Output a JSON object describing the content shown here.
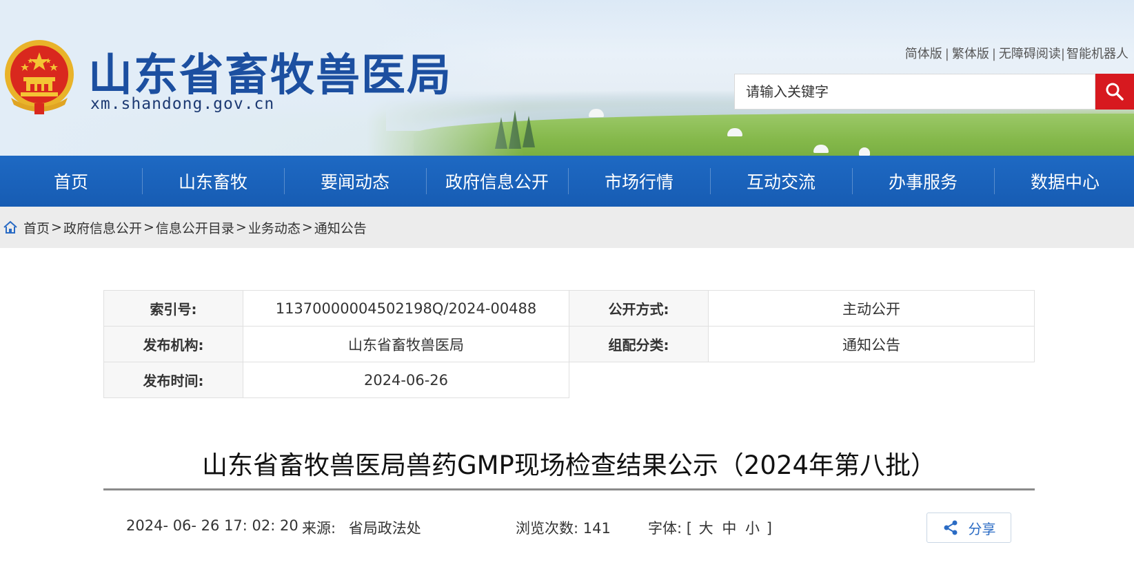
{
  "header": {
    "site_title": "山东省畜牧兽医局",
    "site_domain": "xm.shandong.gov.cn",
    "top_links": [
      "简体版",
      "繁体版",
      "无障碍阅读",
      "智能机器人"
    ],
    "search": {
      "placeholder": "请输入关键字"
    }
  },
  "nav": {
    "items": [
      "首页",
      "山东畜牧",
      "要闻动态",
      "政府信息公开",
      "市场行情",
      "互动交流",
      "办事服务",
      "数据中心"
    ]
  },
  "breadcrumb": [
    "首页",
    "政府信息公开",
    "信息公开目录",
    "业务动态",
    "通知公告"
  ],
  "info": {
    "index_label": "索引号:",
    "index_value": "11370000004502198Q/2024-00488",
    "disclosure_label": "公开方式:",
    "disclosure_value": "主动公开",
    "publisher_label": "发布机构:",
    "publisher_value": "山东省畜牧兽医局",
    "category_label": "组配分类:",
    "category_value": "通知公告",
    "date_label": "发布时间:",
    "date_value": "2024-06-26"
  },
  "article": {
    "title": "山东省畜牧兽医局兽药GMP现场检查结果公示（2024年第八批）",
    "datetime": "2024- 06- 26 17: 02: 20",
    "source_label": "来源:",
    "source_value": "省局政法处",
    "views_label": "浏览次数:",
    "views_value": "141",
    "font_label": "字体:",
    "font_sizes": [
      "大",
      "中",
      "小"
    ],
    "share_label": "分享"
  },
  "colors": {
    "nav_blue": "#1a62bb",
    "title_blue": "#1c4fa0",
    "search_red": "#d7191f",
    "share_blue": "#2a6bc4"
  }
}
